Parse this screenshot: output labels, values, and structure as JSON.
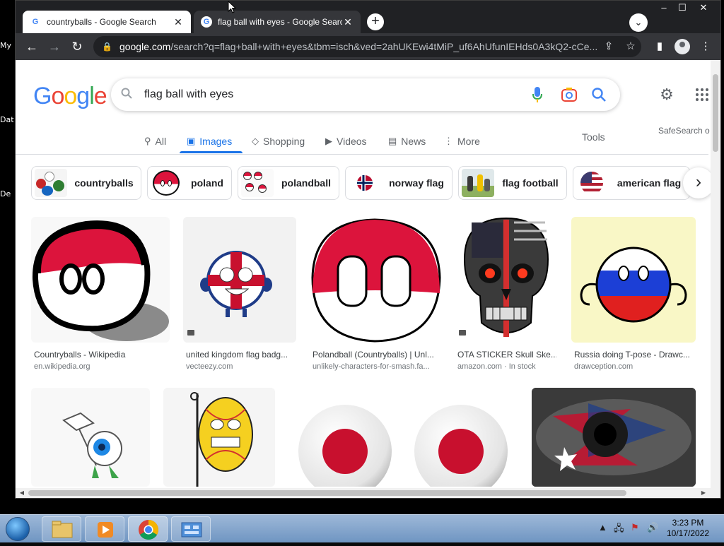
{
  "desktop": {
    "labels": [
      "My",
      "Dat",
      "De"
    ]
  },
  "browser": {
    "tabs": [
      {
        "title": "countryballs - Google Search",
        "active": false
      },
      {
        "title": "flag ball with eyes - Google Search",
        "active": true
      }
    ],
    "window_controls": {
      "minimize": "–",
      "maximize": "☐",
      "close": "✕"
    },
    "address": {
      "host": "google.com",
      "path": "/search?q=flag+ball+with+eyes&tbm=isch&ved=2ahUKEwi4tMiP_uf6AhUfunIEHds0A3kQ2-cCe..."
    }
  },
  "google": {
    "logo": [
      "G",
      "o",
      "o",
      "g",
      "l",
      "e"
    ],
    "logo_colors": [
      "#4285f4",
      "#ea4335",
      "#fbbc05",
      "#4285f4",
      "#34a853",
      "#ea4335"
    ],
    "query": "flag ball with eyes",
    "tabs": [
      {
        "label": "All",
        "icon": "search-icon"
      },
      {
        "label": "Images",
        "icon": "image-icon"
      },
      {
        "label": "Shopping",
        "icon": "tag-icon"
      },
      {
        "label": "Videos",
        "icon": "play-icon"
      },
      {
        "label": "News",
        "icon": "news-icon"
      },
      {
        "label": "More",
        "icon": "more-vert-icon"
      }
    ],
    "selected_tab": "Images",
    "tools": "Tools",
    "safesearch": "SafeSearch o",
    "chips": [
      "countryballs",
      "poland",
      "polandball",
      "norway flag",
      "flag football",
      "american flag"
    ],
    "results_row1": [
      {
        "caption": "Countryballs - Wikipedia",
        "source": "en.wikipedia.org"
      },
      {
        "caption": "united kingdom flag badg...",
        "source": "vecteezy.com"
      },
      {
        "caption": "Polandball (Countryballs) | Unl...",
        "source": "unlikely-characters-for-smash.fa..."
      },
      {
        "caption": "OTA STICKER Skull Ske...",
        "source": "amazon.com · In stock"
      },
      {
        "caption": "Russia doing T-pose - Drawc...",
        "source": "drawception.com"
      }
    ]
  },
  "taskbar": {
    "time": "3:23 PM",
    "date": "10/17/2022"
  },
  "colors": {
    "accent": "#1a73e8",
    "poland_red": "#dc143c",
    "chrome_dark": "#35363a"
  }
}
